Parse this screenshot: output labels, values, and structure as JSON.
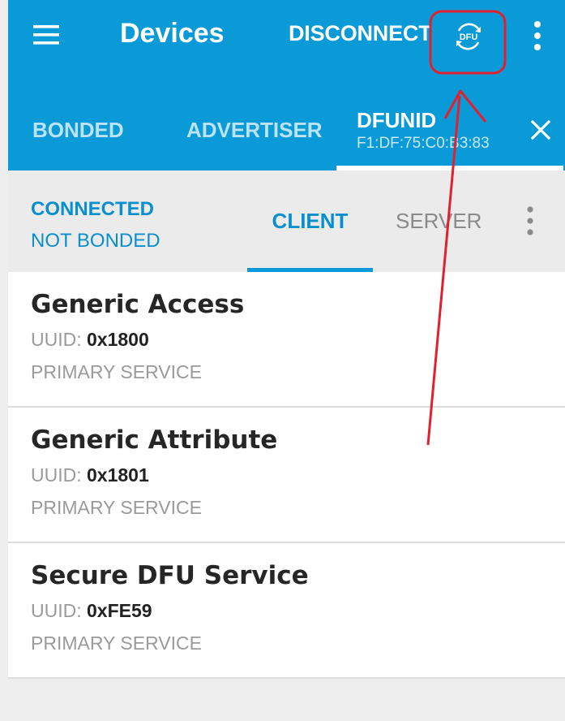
{
  "toolbar": {
    "title": "Devices",
    "disconnect_label": "DISCONNECT",
    "dfu_icon_text": "DFU"
  },
  "tabs": [
    {
      "label": "BONDED"
    },
    {
      "label": "ADVERTISER"
    },
    {
      "label": "DFUNID",
      "address": "F1:DF:75:C0:B3:83",
      "active": true
    }
  ],
  "connection": {
    "state": "CONNECTED",
    "bond_state": "NOT BONDED"
  },
  "subtabs": [
    {
      "label": "CLIENT",
      "active": true
    },
    {
      "label": "SERVER"
    }
  ],
  "services": [
    {
      "name": "Generic Access",
      "uuid_label": "UUID:",
      "uuid": "0x1800",
      "type": "PRIMARY SERVICE"
    },
    {
      "name": "Generic Attribute",
      "uuid_label": "UUID:",
      "uuid": "0x1801",
      "type": "PRIMARY SERVICE"
    },
    {
      "name": "Secure DFU Service",
      "uuid_label": "UUID:",
      "uuid": "0xFE59",
      "type": "PRIMARY SERVICE"
    }
  ],
  "colors": {
    "primary": "#0a9ad8",
    "accent_text": "#0a8fce",
    "annotation": "#e0202e"
  },
  "icons": [
    "menu-icon",
    "dfu-icon",
    "more-vert-icon",
    "close-icon"
  ]
}
